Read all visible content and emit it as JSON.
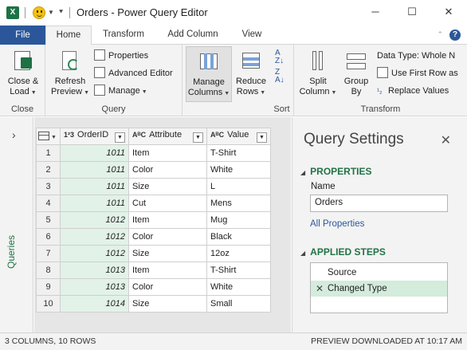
{
  "window": {
    "title": "Orders - Power Query Editor",
    "minimize": "─",
    "maximize": "☐",
    "close": "✕"
  },
  "tabs": {
    "file": "File",
    "home": "Home",
    "transform": "Transform",
    "add_column": "Add Column",
    "view": "View"
  },
  "ribbon": {
    "close_load": "Close &",
    "close_load2": "Load",
    "close_group": "Close",
    "refresh": "Refresh",
    "refresh2": "Preview",
    "properties": "Properties",
    "advanced_editor": "Advanced Editor",
    "manage": "Manage",
    "query_group": "Query",
    "manage_columns": "Manage",
    "manage_columns2": "Columns",
    "reduce_rows": "Reduce",
    "reduce_rows2": "Rows",
    "sort_group": "Sort",
    "split_column": "Split",
    "split_column2": "Column",
    "group_by": "Group",
    "group_by2": "By",
    "data_type": "Data Type: Whole N",
    "use_first_row": "Use First Row as",
    "replace_values": "Replace Values",
    "transform_group": "Transform"
  },
  "queries_pane": {
    "label": "Queries"
  },
  "grid": {
    "columns": [
      {
        "type": "1²3",
        "name": "OrderID"
      },
      {
        "type": "AᴮC",
        "name": "Attribute"
      },
      {
        "type": "AᴮC",
        "name": "Value"
      }
    ],
    "rows": [
      {
        "n": "1",
        "id": "1011",
        "attr": "Item",
        "val": "T-Shirt"
      },
      {
        "n": "2",
        "id": "1011",
        "attr": "Color",
        "val": "White"
      },
      {
        "n": "3",
        "id": "1011",
        "attr": "Size",
        "val": "L"
      },
      {
        "n": "4",
        "id": "1011",
        "attr": "Cut",
        "val": "Mens"
      },
      {
        "n": "5",
        "id": "1012",
        "attr": "Item",
        "val": "Mug"
      },
      {
        "n": "6",
        "id": "1012",
        "attr": "Color",
        "val": "Black"
      },
      {
        "n": "7",
        "id": "1012",
        "attr": "Size",
        "val": "12oz"
      },
      {
        "n": "8",
        "id": "1013",
        "attr": "Item",
        "val": "T-Shirt"
      },
      {
        "n": "9",
        "id": "1013",
        "attr": "Color",
        "val": "White"
      },
      {
        "n": "10",
        "id": "1014",
        "attr": "Size",
        "val": "Small"
      }
    ]
  },
  "query_settings": {
    "title": "Query Settings",
    "properties_heading": "PROPERTIES",
    "name_label": "Name",
    "name_value": "Orders",
    "all_properties": "All Properties",
    "applied_steps_heading": "APPLIED STEPS",
    "steps": [
      "Source",
      "Changed Type"
    ]
  },
  "status": {
    "left": "3 COLUMNS, 10 ROWS",
    "right": "PREVIEW DOWNLOADED AT 10:17 AM"
  },
  "colors": {
    "accent_green": "#217346",
    "file_tab_blue": "#2b579a"
  }
}
